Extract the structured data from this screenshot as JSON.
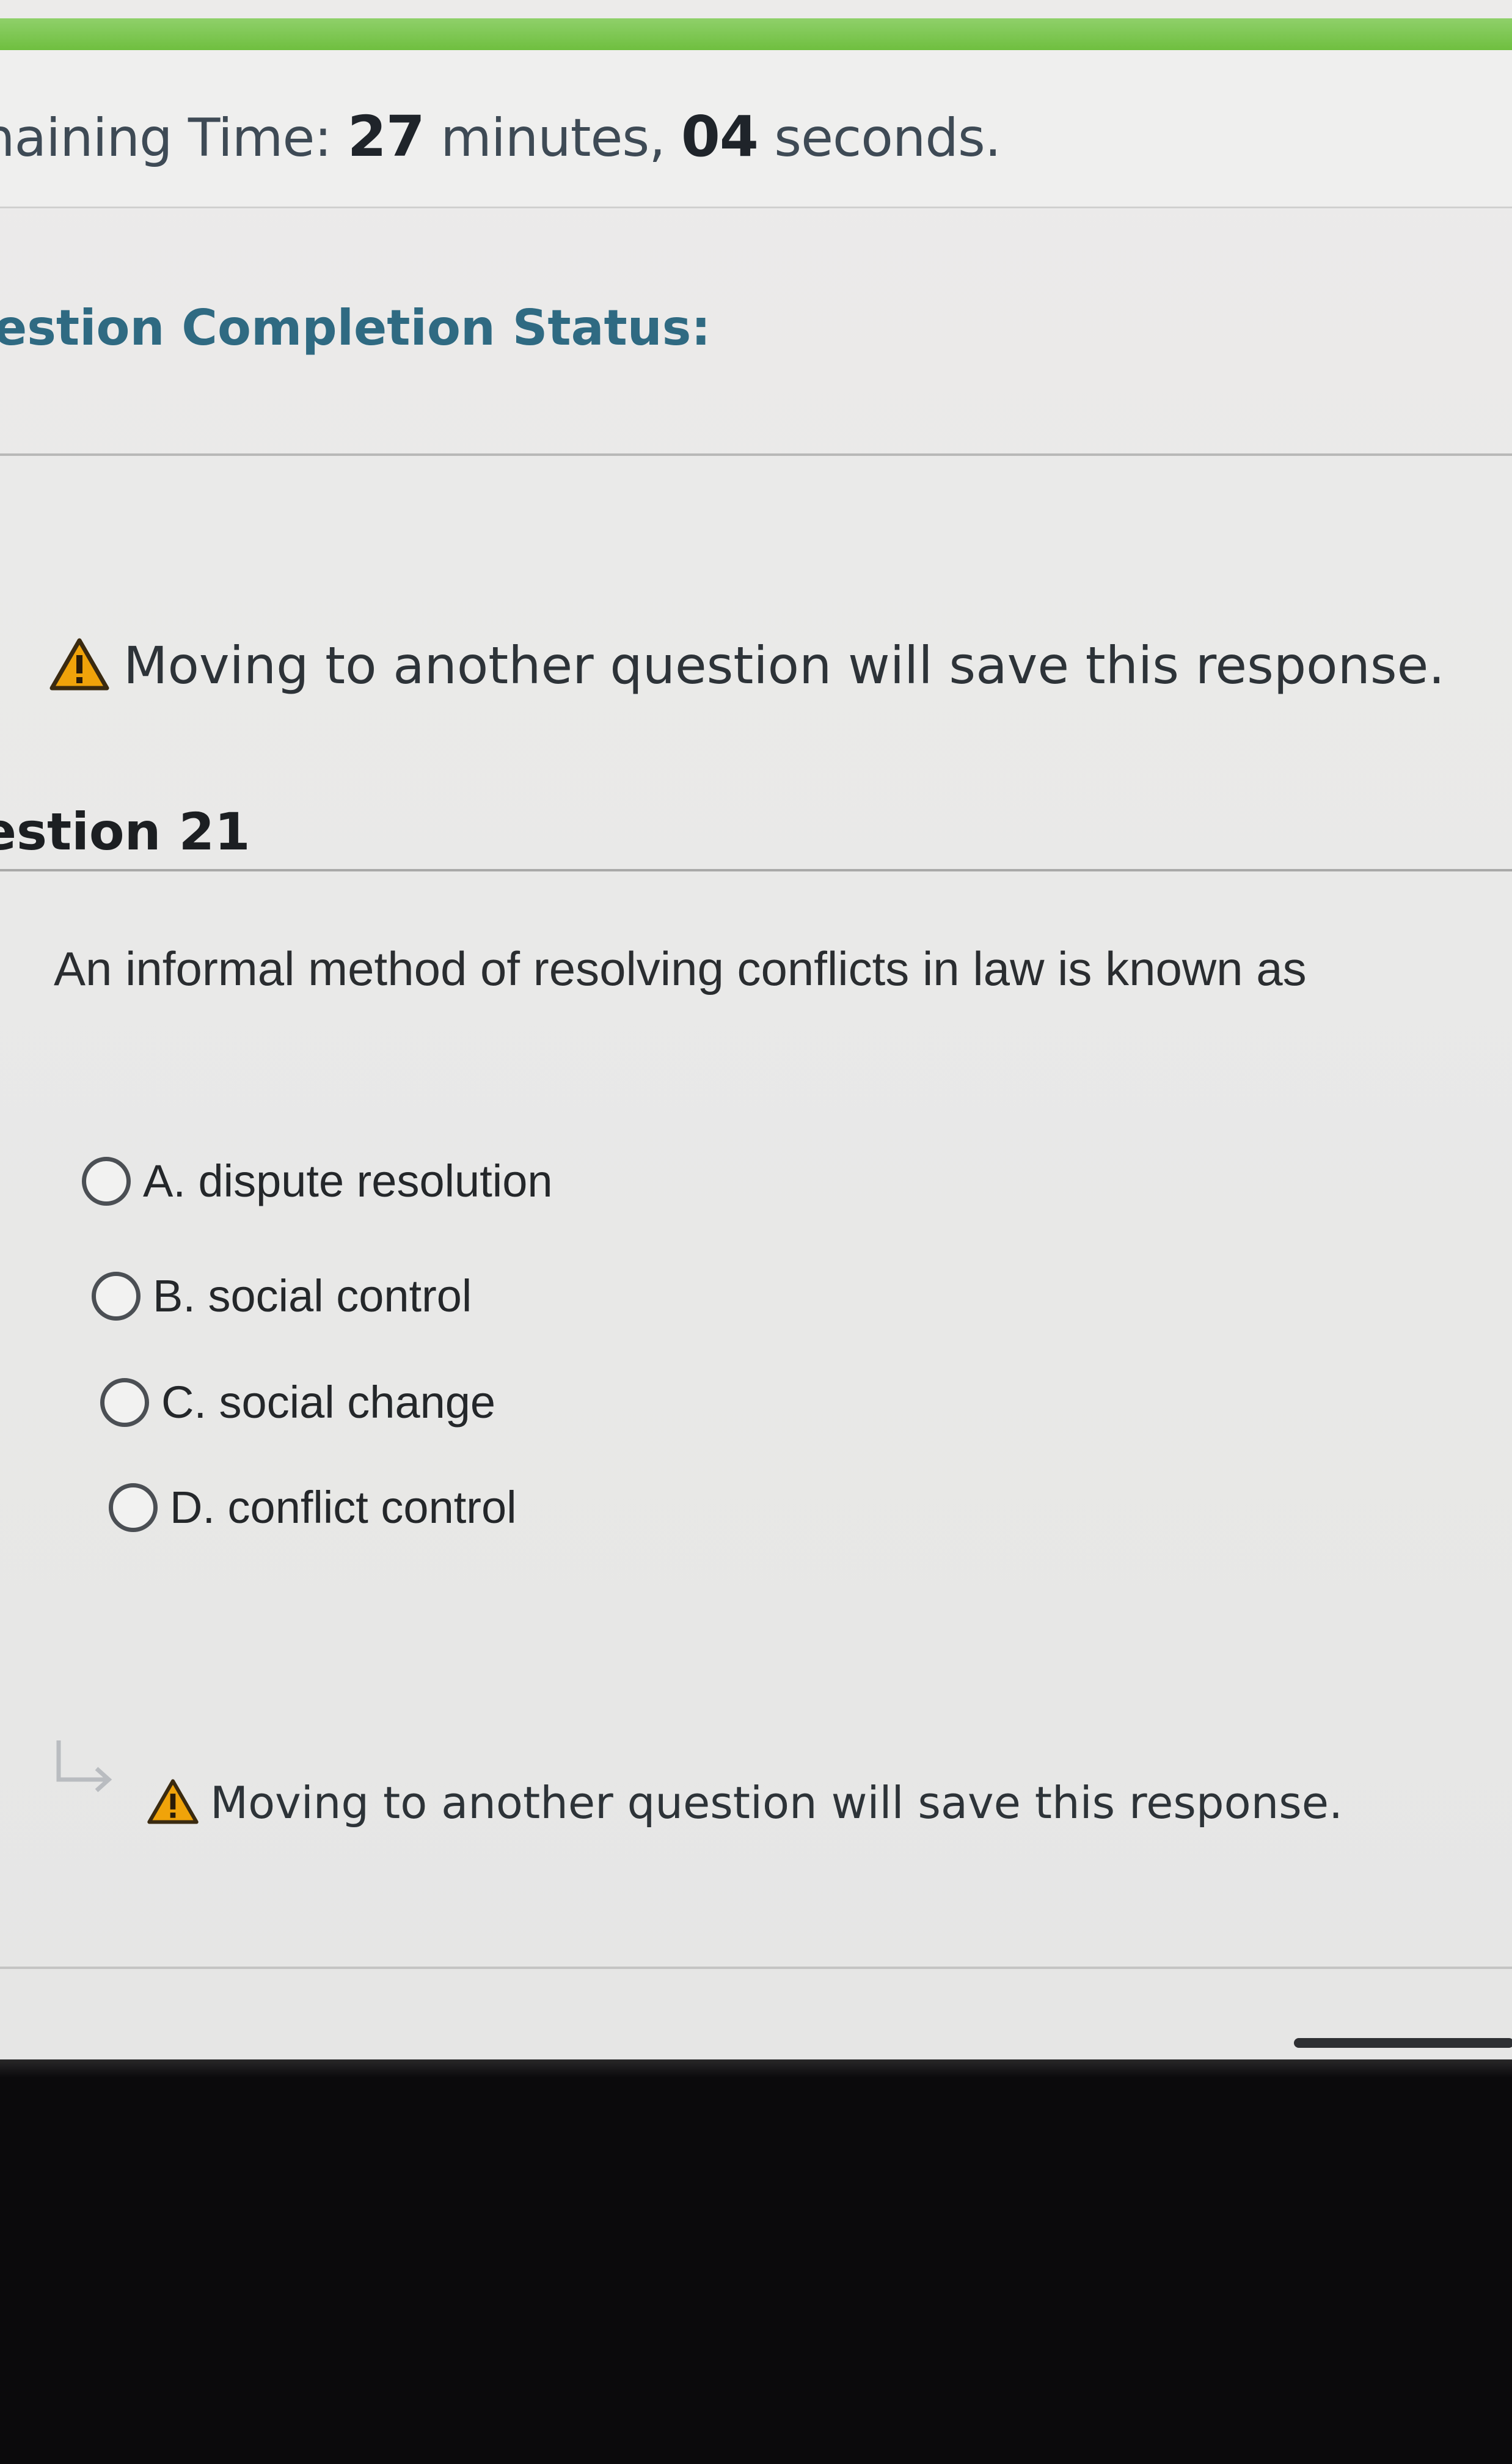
{
  "timer": {
    "prefix": "naining Time: ",
    "minutes": "27",
    "minutes_unit": " minutes, ",
    "seconds": "04",
    "seconds_unit": " seconds."
  },
  "completion_status_label": "estion Completion Status:",
  "warning_top": "Moving to another question will save this response.",
  "question": {
    "number_label": "estion 21",
    "text": "An informal method of resolving conflicts in law is known as",
    "choices": [
      {
        "label": "A. dispute resolution",
        "selected": false
      },
      {
        "label": "B. social control",
        "selected": false
      },
      {
        "label": "C. social change",
        "selected": false
      },
      {
        "label": "D. conflict control",
        "selected": false
      }
    ]
  },
  "warning_bottom": "Moving to another question will save this response.",
  "colors": {
    "accent_green": "#6fbf3f",
    "status_label": "#2f6a82",
    "warning_fill": "#f0a30a"
  },
  "icons": [
    "warning-icon",
    "return-arrow-icon",
    "radio-button"
  ]
}
